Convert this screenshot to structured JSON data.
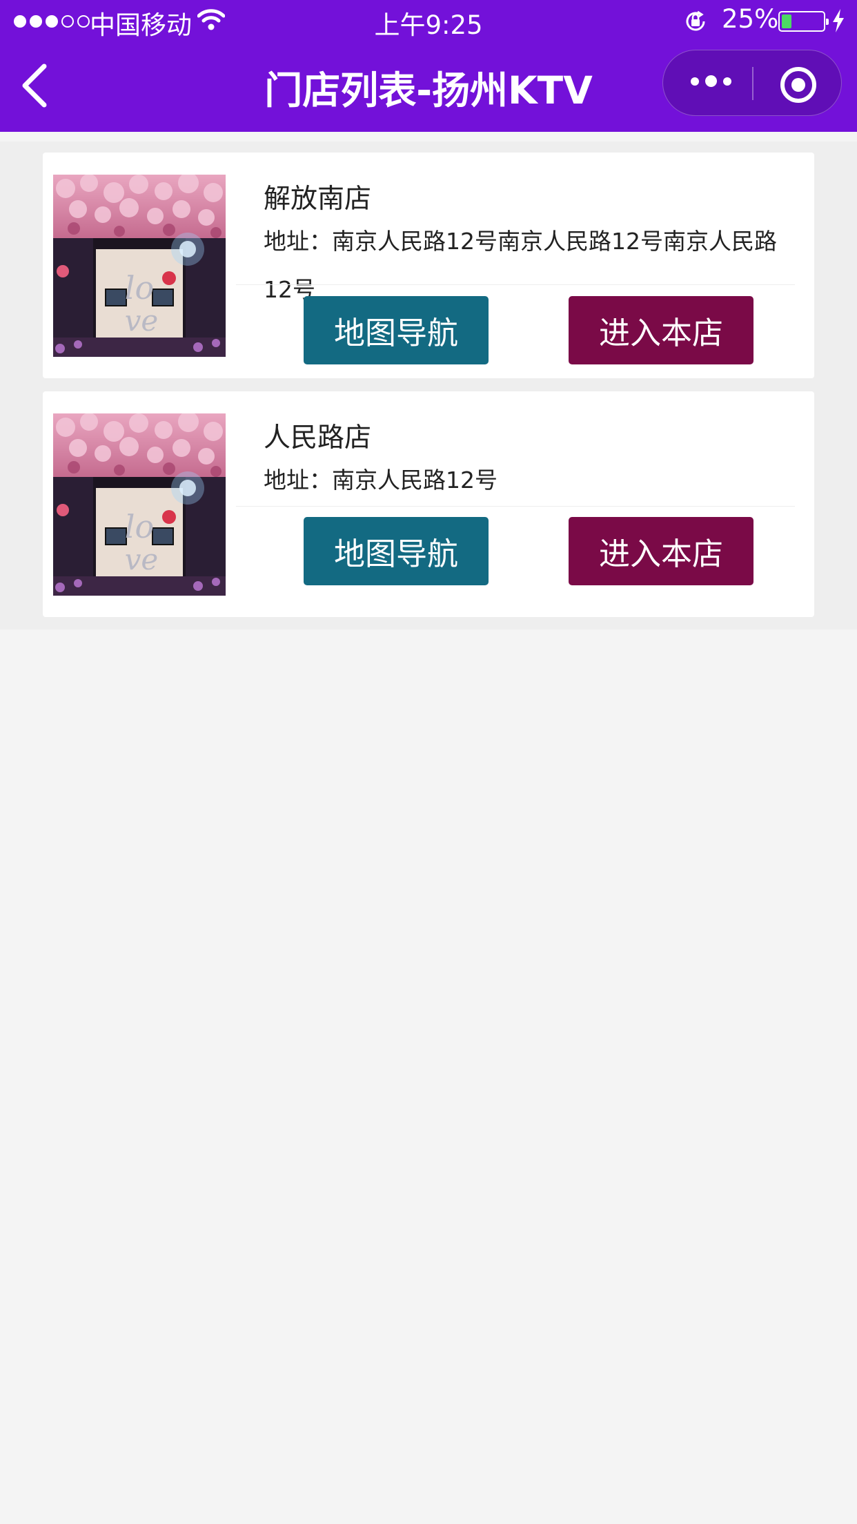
{
  "status_bar": {
    "carrier": "中国移动",
    "time": "上午9:25",
    "battery_percent": "25%",
    "battery_level": 0.25,
    "signal_bars": 3
  },
  "nav": {
    "title": "门店列表-扬州KTV"
  },
  "stores": [
    {
      "name": "解放南店",
      "address": "地址：南京人民路12号南京人民路12号南京人民路12号",
      "map_button": "地图导航",
      "enter_button": "进入本店"
    },
    {
      "name": "人民路店",
      "address": "地址：南京人民路12号",
      "map_button": "地图导航",
      "enter_button": "进入本店"
    }
  ],
  "colors": {
    "header": "#7311d9",
    "map_button": "#136a82",
    "enter_button": "#7a0a47",
    "battery_fill": "#4cd964"
  }
}
